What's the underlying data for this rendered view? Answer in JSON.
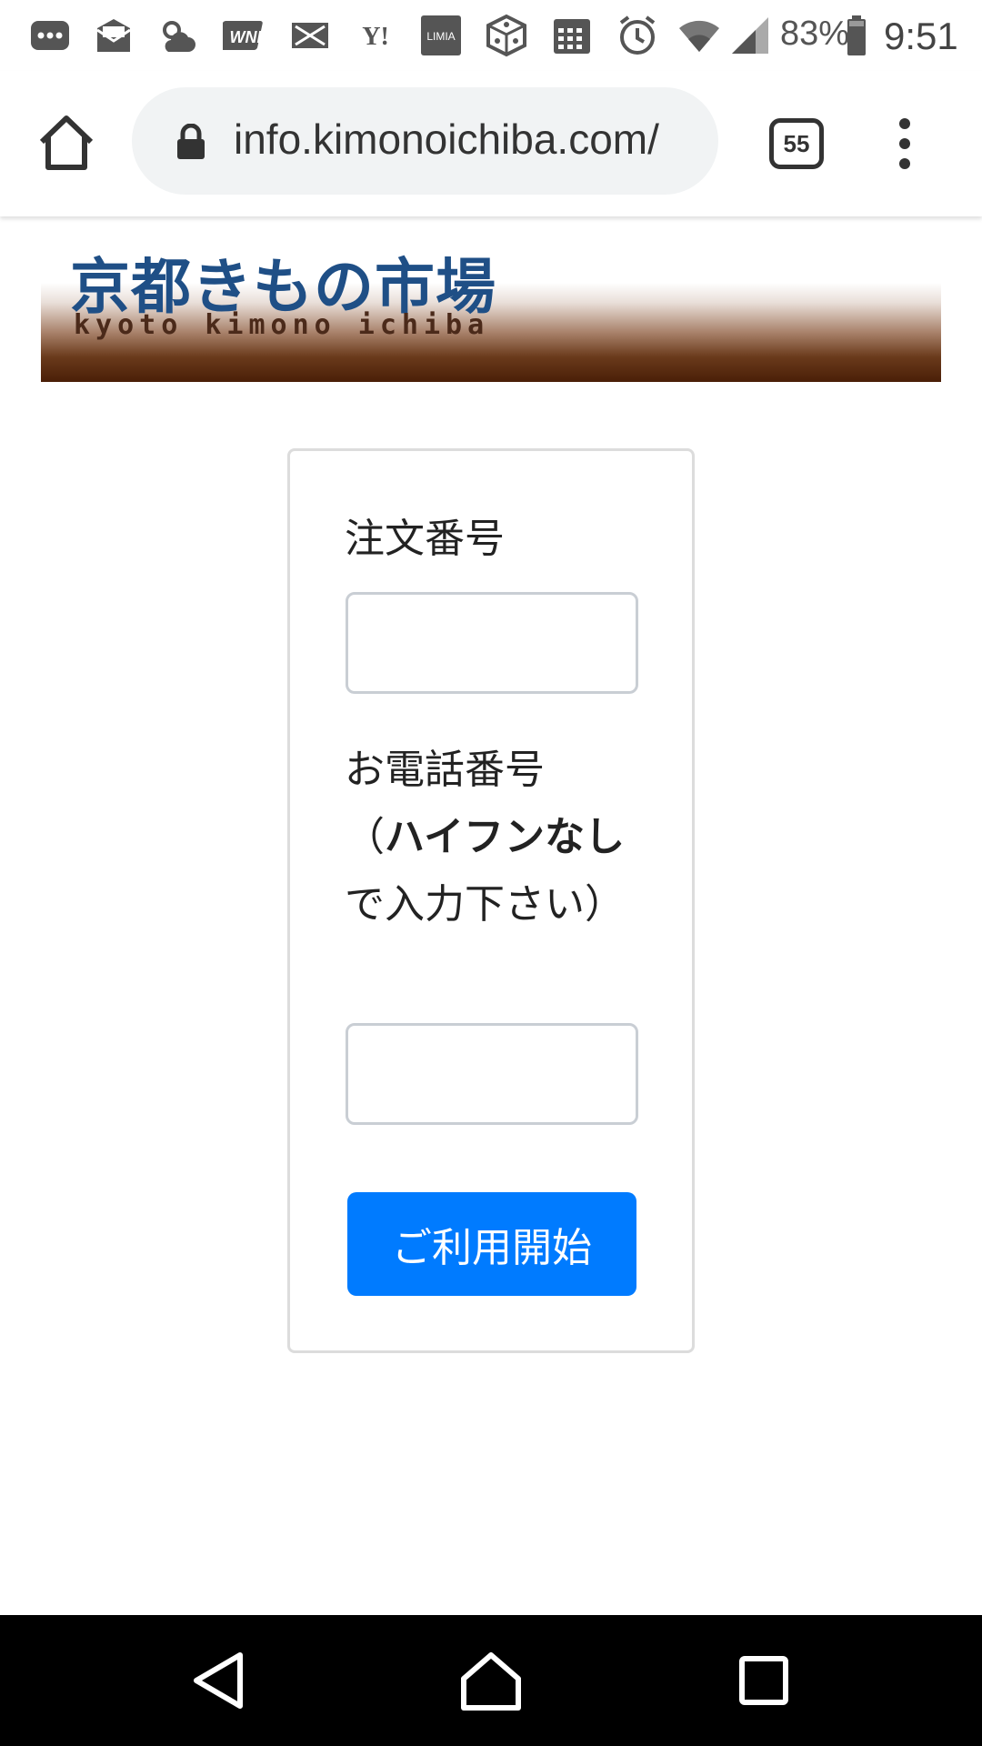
{
  "status_bar": {
    "icons": [
      "chat-icon",
      "mail-icon",
      "weather-icon",
      "wni-icon",
      "mail-x-icon",
      "yahoo-icon",
      "limia-icon",
      "dice-icon",
      "calendar-icon",
      "alarm-icon",
      "wifi-icon",
      "signal-icon",
      "battery-icon"
    ],
    "wni_text": "WNI",
    "yahoo_text": "Y!",
    "limia_text": "LIMIA",
    "battery": "83%",
    "time": "9:51"
  },
  "browser": {
    "url": "info.kimonoichiba.com/",
    "tab_count": "55"
  },
  "banner": {
    "title_jp": "京都きもの市場",
    "title_en": "kyoto kimono ichiba"
  },
  "form": {
    "order_label": "注文番号",
    "order_value": "",
    "phone_label_lead": "お電話番号",
    "phone_label_paren_open": "（",
    "phone_label_bold": "ハイフンなし",
    "phone_label_tail": "で入力下さい）",
    "phone_value": "",
    "submit_label": "ご利用開始"
  },
  "colors": {
    "accent": "#007bff",
    "logo_blue": "#1f4f86",
    "banner_brown": "#4a1f07"
  }
}
